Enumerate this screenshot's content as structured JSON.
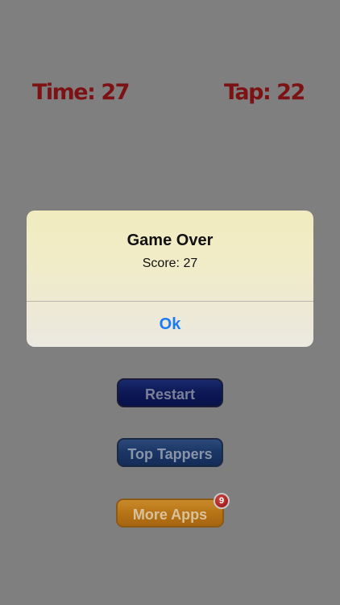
{
  "hud": {
    "time": "Time: 27",
    "tap": "Tap: 22"
  },
  "buttons": {
    "restart": "Restart",
    "top_tappers": "Top Tappers",
    "more_apps": "More Apps",
    "more_apps_badge": "9"
  },
  "alert": {
    "title": "Game Over",
    "message": "Score: 27",
    "ok": "Ok"
  },
  "colors": {
    "background": "#7f7f7f",
    "hud_text": "#7d1214",
    "alert_link": "#1a7cf4",
    "badge": "#a41e1c"
  }
}
